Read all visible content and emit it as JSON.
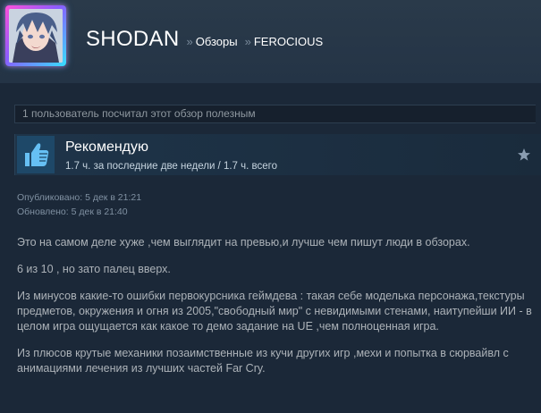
{
  "header": {
    "username": "SHODAN",
    "separator": "»",
    "crumb_reviews": "Обзоры",
    "crumb_game": "FEROCIOUS"
  },
  "helpful": {
    "text": "1 пользователь посчитал этот обзор полезным"
  },
  "recommendation": {
    "title": "Рекомендую",
    "hours": "1.7 ч. за последние две недели / 1.7 ч. всего",
    "icon": "thumbs-up-icon"
  },
  "dates": {
    "published": "Опубликовано: 5 дек в 21:21",
    "updated": "Обновлено: 5 дек в 21:40"
  },
  "review": {
    "paragraphs": [
      "Это на самом деле хуже ,чем выглядит на превью,и лучше чем пишут люди в обзорах.",
      "6 из 10 , но зато палец вверх.",
      "Из минусов какие-то ошибки первокурсника геймдева : такая себе моделька персонажа,текстуры предметов, окружения и огня из 2005,\"свободный мир\" с невидимыми стенами, наитупейши ИИ - в целом игра ощущается как какое то демо задание на UE ,чем полноценная игра.",
      "Из плюсов крутые механики позаимственные из кучи других игр ,мехи и попытка в сюрвайвл с анимациями лечения из лучших частей Far Cry."
    ]
  },
  "colors": {
    "background": "#1b2838",
    "accent_blue": "#66c0f4",
    "text_body": "#acb2b8"
  }
}
